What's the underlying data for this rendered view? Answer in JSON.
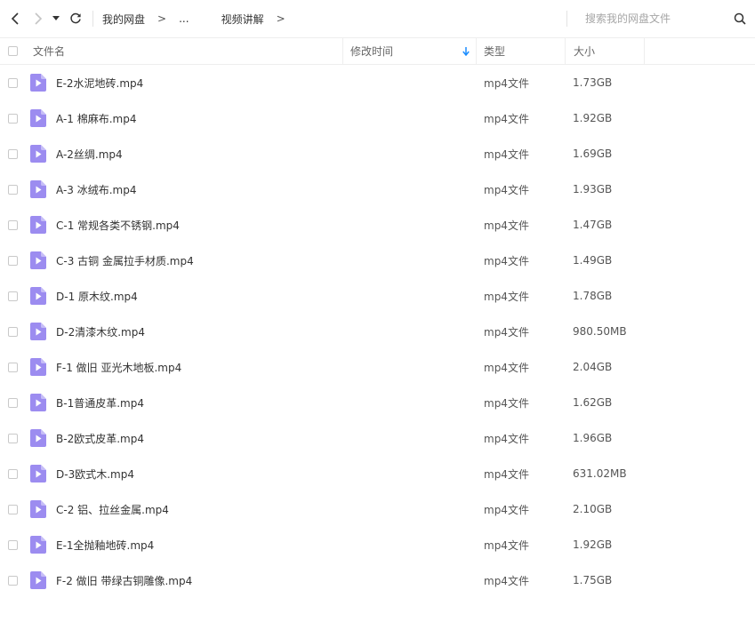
{
  "toolbar": {
    "breadcrumb": {
      "root": "我的网盘",
      "ellipsis": "...",
      "current": "视频讲解",
      "separator": ">"
    },
    "search_placeholder": "搜索我的网盘文件"
  },
  "columns": {
    "name": "文件名",
    "modified": "修改时间",
    "type": "类型",
    "size": "大小"
  },
  "accent_color": "#1a8cff",
  "file_icon_color": "#9c8cf0",
  "files": [
    {
      "name": "E-2水泥地砖.mp4",
      "type": "mp4文件",
      "size": "1.73GB"
    },
    {
      "name": "A-1 棉麻布.mp4",
      "type": "mp4文件",
      "size": "1.92GB"
    },
    {
      "name": "A-2丝绸.mp4",
      "type": "mp4文件",
      "size": "1.69GB"
    },
    {
      "name": "A-3 冰绒布.mp4",
      "type": "mp4文件",
      "size": "1.93GB"
    },
    {
      "name": "C-1 常规各类不锈钢.mp4",
      "type": "mp4文件",
      "size": "1.47GB"
    },
    {
      "name": "C-3 古铜 金属拉手材质.mp4",
      "type": "mp4文件",
      "size": "1.49GB"
    },
    {
      "name": "D-1 原木纹.mp4",
      "type": "mp4文件",
      "size": "1.78GB"
    },
    {
      "name": "D-2清漆木纹.mp4",
      "type": "mp4文件",
      "size": "980.50MB"
    },
    {
      "name": "F-1 做旧 亚光木地板.mp4",
      "type": "mp4文件",
      "size": "2.04GB"
    },
    {
      "name": "B-1普通皮革.mp4",
      "type": "mp4文件",
      "size": "1.62GB"
    },
    {
      "name": "B-2欧式皮革.mp4",
      "type": "mp4文件",
      "size": "1.96GB"
    },
    {
      "name": "D-3欧式木.mp4",
      "type": "mp4文件",
      "size": "631.02MB"
    },
    {
      "name": "C-2 铝、拉丝金属.mp4",
      "type": "mp4文件",
      "size": "2.10GB"
    },
    {
      "name": "E-1全抛釉地砖.mp4",
      "type": "mp4文件",
      "size": "1.92GB"
    },
    {
      "name": "F-2 做旧 带绿古铜雕像.mp4",
      "type": "mp4文件",
      "size": "1.75GB"
    }
  ]
}
